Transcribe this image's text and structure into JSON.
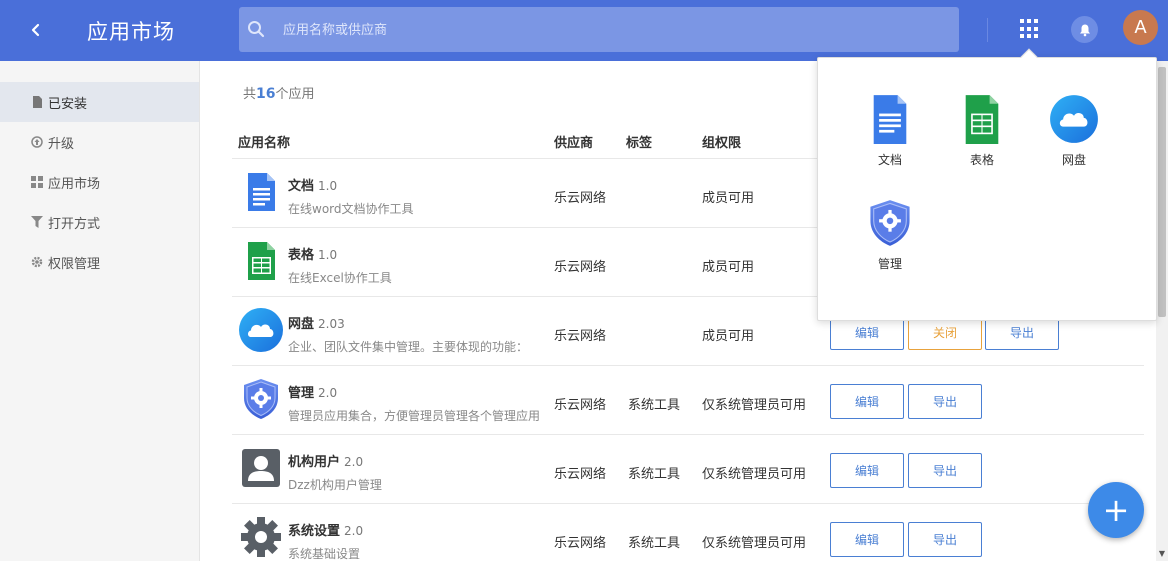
{
  "header": {
    "title": "应用市场",
    "search_placeholder": "应用名称或供应商",
    "avatar_letter": "A",
    "bg_color": "#4a6fd9"
  },
  "sidebar": {
    "items": [
      {
        "label": "已安装",
        "icon": "file-icon",
        "active": true
      },
      {
        "label": "升级",
        "icon": "upgrade-icon"
      },
      {
        "label": "应用市场",
        "icon": "grid-icon"
      },
      {
        "label": "打开方式",
        "icon": "filter-icon"
      },
      {
        "label": "权限管理",
        "icon": "gear-icon"
      }
    ]
  },
  "main": {
    "count_prefix": "共",
    "count": "16",
    "count_suffix": "个应用",
    "columns": [
      "应用名称",
      "供应商",
      "标签",
      "组权限"
    ],
    "rows": [
      {
        "name": "文档",
        "version": "1.0",
        "desc": "在线word文档协作工具",
        "vendor": "乐云网络",
        "tag": "",
        "perm": "成员可用",
        "icon": "doc-icon",
        "buttons": []
      },
      {
        "name": "表格",
        "version": "1.0",
        "desc": "在线Excel协作工具",
        "vendor": "乐云网络",
        "tag": "",
        "perm": "成员可用",
        "icon": "sheet-icon",
        "buttons": []
      },
      {
        "name": "网盘",
        "version": "2.03",
        "desc": "企业、团队文件集中管理。主要体现的功能：",
        "vendor": "乐云网络",
        "tag": "",
        "perm": "成员可用",
        "icon": "cloud-icon",
        "buttons": [
          "编辑",
          "关闭",
          "导出"
        ]
      },
      {
        "name": "管理",
        "version": "2.0",
        "desc": "管理员应用集合，方便管理员管理各个管理应用",
        "vendor": "乐云网络",
        "tag": "系统工具",
        "perm": "仅系统管理员可用",
        "icon": "admin-shield-icon",
        "buttons": [
          "编辑",
          "导出"
        ]
      },
      {
        "name": "机构用户",
        "version": "2.0",
        "desc": "Dzz机构用户管理",
        "vendor": "乐云网络",
        "tag": "系统工具",
        "perm": "仅系统管理员可用",
        "icon": "user-card-icon",
        "buttons": [
          "编辑",
          "导出"
        ]
      },
      {
        "name": "系统设置",
        "version": "2.0",
        "desc": "系统基础设置",
        "vendor": "乐云网络",
        "tag": "系统工具",
        "perm": "仅系统管理员可用",
        "icon": "settings-gear-icon",
        "buttons": [
          "编辑",
          "导出"
        ]
      }
    ]
  },
  "dropdown": {
    "items": [
      {
        "label": "文档",
        "icon": "doc-icon"
      },
      {
        "label": "表格",
        "icon": "sheet-icon"
      },
      {
        "label": "网盘",
        "icon": "cloud-icon"
      },
      {
        "label": "管理",
        "icon": "admin-shield-icon"
      }
    ]
  },
  "fab": {
    "label": "+"
  }
}
